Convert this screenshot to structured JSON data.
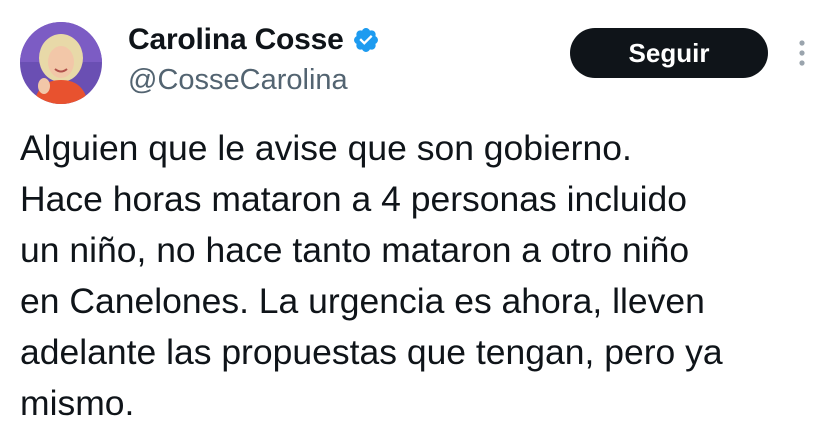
{
  "author": {
    "display_name": "Carolina Cosse",
    "handle": "@CosseCarolina",
    "verified": true,
    "avatar_icon": "profile-photo"
  },
  "actions": {
    "follow_label": "Seguir",
    "more_icon": "more-vertical-icon"
  },
  "tweet": {
    "text": "Alguien que le avise que son gobierno.\nHace horas mataron a 4 personas incluido\nun niño, no hace tanto mataron a otro niño\nen Canelones. La urgencia es ahora, lleven\nadelante las propuestas que tengan, pero ya\nmismo."
  },
  "colors": {
    "text": "#0f1419",
    "secondary": "#536471",
    "verified_badge": "#1d9bf0",
    "button_bg": "#0f1419",
    "button_text": "#ffffff"
  }
}
